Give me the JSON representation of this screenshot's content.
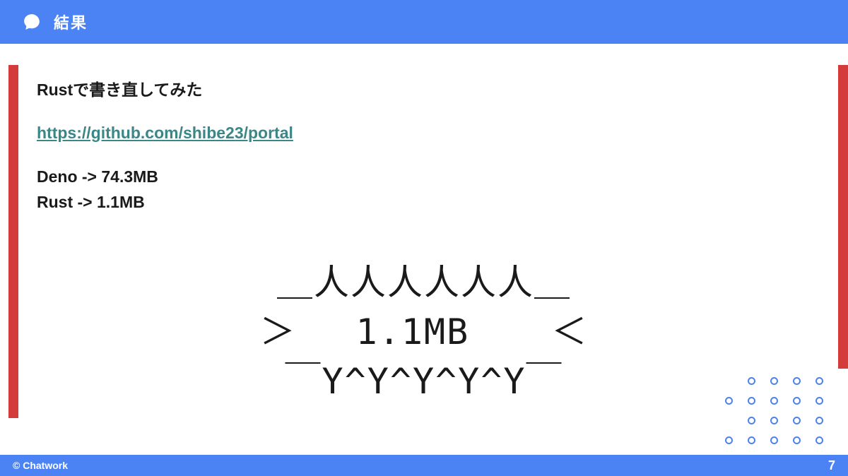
{
  "header": {
    "title": "結果"
  },
  "content": {
    "intro": "Rustで書き直してみた",
    "repo_url": "https://github.com/shibe23/portal",
    "size_deno": "Deno -> 74.3MB",
    "size_rust": "Rust -> 1.1MB",
    "ascii_line1": "＿人人人人人人＿",
    "ascii_line2": "＞　 1.1MB 　 ＜",
    "ascii_line3": "￣Y^Y^Y^Y^Y￣"
  },
  "footer": {
    "copyright": "© Chatwork",
    "page": "7"
  }
}
